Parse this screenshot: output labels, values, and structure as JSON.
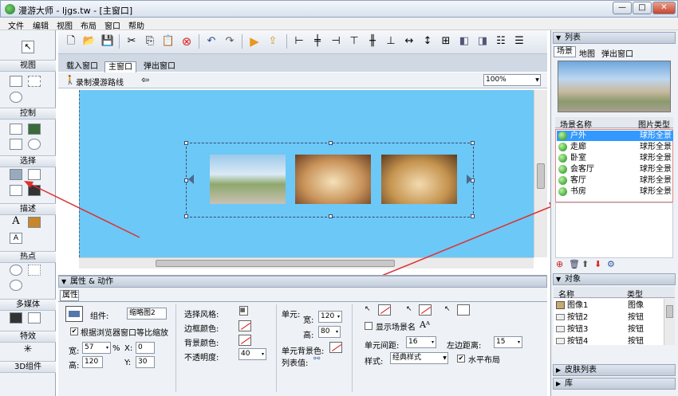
{
  "window": {
    "title": "漫游大师 - ljgs.tw - [主窗口]",
    "min": "—",
    "max": "□",
    "close": "✕"
  },
  "menu": [
    "文件",
    "编辑",
    "视图",
    "布局",
    "窗口",
    "帮助"
  ],
  "left": {
    "sections": [
      "视图",
      "控制",
      "选择",
      "描述",
      "热点",
      "多媒体",
      "特效",
      "3D组件"
    ]
  },
  "tabs": [
    "载入窗口",
    "主窗口",
    "弹出窗口"
  ],
  "subbar": {
    "record": "录制漫游路线",
    "zoom": "100%"
  },
  "props": {
    "header": "属性 & 动作",
    "tab": "属性",
    "component_label": "组件:",
    "component_value": "缩略图2",
    "scale_checkbox": "根据浏览器窗口等比缩放",
    "width_label": "宽:",
    "width_value": "57",
    "width_unit": "%",
    "height_label": "高:",
    "height_value": "120",
    "x_label": "X:",
    "x_value": "0",
    "y_label": "Y:",
    "y_value": "30",
    "select_style": "选择风格:",
    "border_color": "边框颜色:",
    "bg_color": "背景颜色:",
    "opacity_label": "不透明度:",
    "opacity_value": "40",
    "cell_label": "单元:",
    "cell_width_label": "宽:",
    "cell_width": "120",
    "cell_height_label": "高:",
    "cell_height": "80",
    "cell_bg": "单元背景色:",
    "list_value": "列表值:",
    "show_scene_name": "显示场景名",
    "cell_spacing_label": "单元间距:",
    "cell_spacing": "16",
    "left_margin_label": "左边距离:",
    "left_margin": "15",
    "style_label": "样式:",
    "style_value": "经典样式",
    "horizontal_layout": "水平布局"
  },
  "right": {
    "list_header": "列表",
    "tabs": [
      "场景",
      "地图",
      "弹出窗口"
    ],
    "columns": [
      "场景名称",
      "图片类型"
    ],
    "scenes": [
      {
        "name": "户外",
        "type": "球形全景"
      },
      {
        "name": "走廊",
        "type": "球形全景"
      },
      {
        "name": "卧室",
        "type": "球形全景"
      },
      {
        "name": "会客厅",
        "type": "球形全景"
      },
      {
        "name": "客厅",
        "type": "球形全景"
      },
      {
        "name": "书房",
        "type": "球形全景"
      }
    ],
    "objects_header": "对象",
    "obj_columns": [
      "名称",
      "类型"
    ],
    "objects": [
      {
        "name": "图像1",
        "type": "图像"
      },
      {
        "name": "按钮2",
        "type": "按钮"
      },
      {
        "name": "按钮3",
        "type": "按钮"
      },
      {
        "name": "按钮4",
        "type": "按钮"
      }
    ],
    "skin_list": "皮肤列表",
    "library": "库"
  },
  "colors": {
    "canvas": "#6cc8f6",
    "selected_row": "#3399ff",
    "accent": "#e03030"
  }
}
